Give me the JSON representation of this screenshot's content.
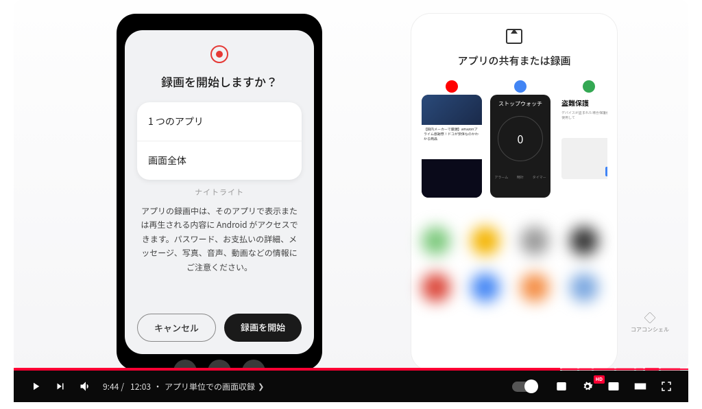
{
  "player": {
    "current_time": "9:44",
    "duration": "12:03",
    "separator": "/",
    "chapter_prefix": "・",
    "chapter_title": "アプリ単位での画面収録",
    "hd_label": "HD"
  },
  "left_dialog": {
    "title": "録画を開始しますか？",
    "option_single_app": "1 つのアプリ",
    "option_full_screen": "画面全体",
    "hidden_label": "ナイトライト",
    "body_text": "アプリの録画中は、そのアプリで表示または再生される内容に Android がアクセスできます。パスワード、お支払いの詳細、メッセージ、写真、音声、動画などの情報にご注意ください。",
    "cancel": "キャンセル",
    "start": "録画を開始"
  },
  "right_panel": {
    "title": "アプリの共有または録画",
    "cards": {
      "youtube_meta": "【国内メーカーで厳選】amazonプライム感謝祭！ドコが安値なのかわかる商品",
      "stopwatch_title": "ストップウォッチ",
      "stopwatch_value": "0",
      "stopwatch_tabs": {
        "alarm": "アラーム",
        "clock": "時計",
        "timer": "タイマー"
      },
      "theft_title": "盗難保護",
      "theft_sub": "デバイスが盗まれた場合保護機能を使用して"
    }
  },
  "branding": {
    "name": "コアコンシェル"
  },
  "icon_colors": {
    "youtube": "#ff0000",
    "clock": "#4285f4",
    "family": "#34a853"
  },
  "blur_blobs": [
    "#7cc97c",
    "#f4b400",
    "#999999",
    "#333333",
    "#db4437",
    "#4285f4",
    "#f48c42",
    "#7aa7e0"
  ]
}
